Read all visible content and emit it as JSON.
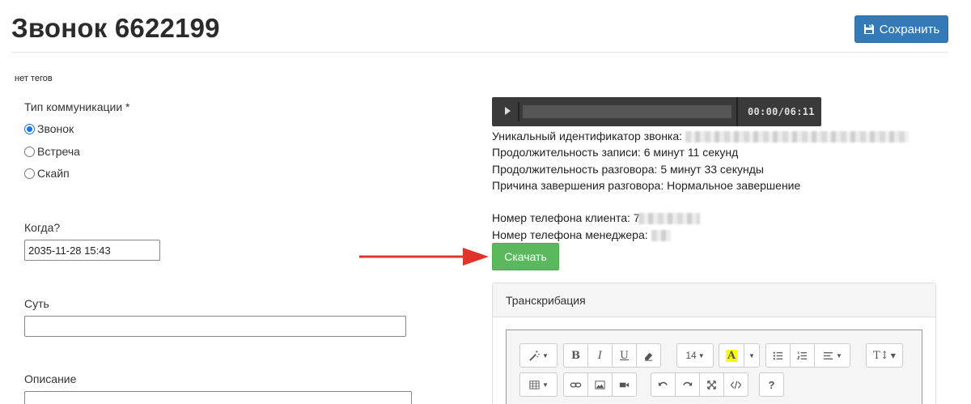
{
  "header": {
    "title": "Звонок 6622199",
    "save_label": "Сохранить",
    "tags_text": "нет тегов"
  },
  "form": {
    "comm_type_label": "Тип коммуникации *",
    "comm_types": [
      {
        "label": "Звонок",
        "checked": true
      },
      {
        "label": "Встреча",
        "checked": false
      },
      {
        "label": "Скайп",
        "checked": false
      }
    ],
    "when_label": "Когда?",
    "when_value": "2035-11-28 15:43",
    "essence_label": "Суть",
    "essence_value": "",
    "description_label": "Описание"
  },
  "player": {
    "current_time": "00:00",
    "separator": "/",
    "duration": "06:11"
  },
  "call_info": {
    "unique_id_label": "Уникальный идентификатор звонка:",
    "record_duration": "Продолжительность записи: 6 минут 11 секунд",
    "talk_duration": "Продолжительность разговора: 5 минут 33 секунды",
    "end_reason": "Причина завершения разговора: Нормальное завершение",
    "client_phone_label": "Номер телефона клиента:",
    "client_phone_visible": "7",
    "manager_phone_label": "Номер телефона менеджера:"
  },
  "download_label": "Скачать",
  "transcription": {
    "title": "Транскрибация",
    "font_size": "14"
  },
  "colors": {
    "primary": "#337ab7",
    "success": "#5cb85c",
    "arrow": "#e0332b",
    "highlight": "#ffff00"
  }
}
